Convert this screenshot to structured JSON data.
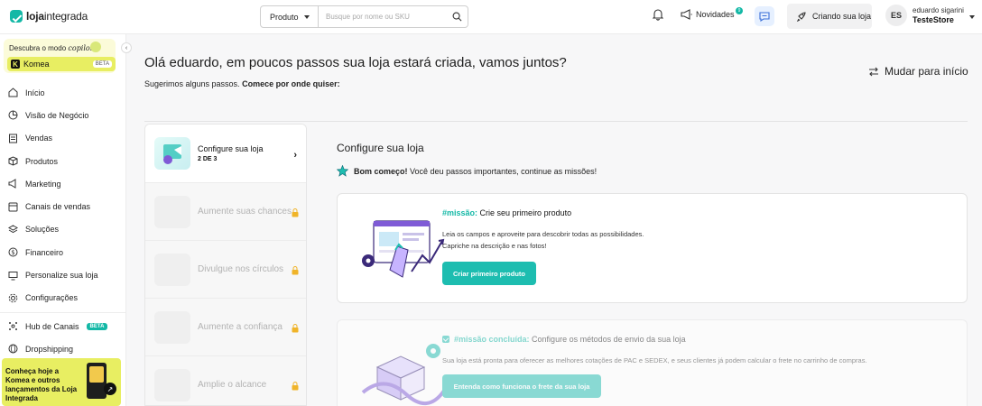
{
  "brand": {
    "name_bold": "loja",
    "name_rest": "integrada",
    "accent": "#13b8a6"
  },
  "topbar": {
    "search_select": "Produto",
    "search_placeholder": "Busque por nome ou SKU",
    "novidades_label": "Novidades",
    "novidades_count": "9",
    "create_store_label": "Criando sua loja",
    "user_initials": "ES",
    "user_name": "eduardo sigarini",
    "user_store": "TesteStore"
  },
  "sidebar": {
    "copilot_title_prefix": "Descubra o modo",
    "copilot_title_italic": "copiloto",
    "komea_label": "Komea",
    "komea_badge": "BETA",
    "collapse_icon": "‹",
    "items": [
      {
        "label": "Início",
        "icon": "home-icon"
      },
      {
        "label": "Visão de Negócio",
        "icon": "chart-icon"
      },
      {
        "label": "Vendas",
        "icon": "receipt-icon"
      },
      {
        "label": "Produtos",
        "icon": "box-icon"
      },
      {
        "label": "Marketing",
        "icon": "megaphone-icon"
      },
      {
        "label": "Canais de vendas",
        "icon": "channels-icon"
      },
      {
        "label": "Soluções",
        "icon": "layers-icon"
      },
      {
        "label": "Financeiro",
        "icon": "dollar-icon"
      },
      {
        "label": "Personalize sua loja",
        "icon": "monitor-icon"
      },
      {
        "label": "Configurações",
        "icon": "gear-icon"
      }
    ],
    "extra_items": [
      {
        "label": "Hub de Canais",
        "badge": "BETA",
        "icon": "hub-icon"
      },
      {
        "label": "Dropshipping",
        "icon": "globe-icon"
      }
    ],
    "promo_text": "Conheça hoje a Komea e outros lançamentos da Loja Integrada",
    "promo_arrow": "↗"
  },
  "main": {
    "greeting": "Olá eduardo, em poucos passos sua loja estará criada, vamos juntos?",
    "sub_plain": "Sugerimos alguns passos.",
    "sub_bold": "Comece por onde quiser:",
    "switch_label": "Mudar para início"
  },
  "steps": [
    {
      "label": "Configure sua loja",
      "progress": "2 DE 3",
      "state": "active"
    },
    {
      "label": "Aumente suas chances",
      "state": "locked"
    },
    {
      "label": "Divulgue nos círculos",
      "state": "locked"
    },
    {
      "label": "Aumente a confiança",
      "state": "locked"
    },
    {
      "label": "Amplie o alcance",
      "state": "locked"
    }
  ],
  "panel": {
    "title": "Configure sua loja",
    "sub_bold": "Bom começo!",
    "sub_rest": "Você deu passos importantes, continue as missões!"
  },
  "missions": [
    {
      "tag": "#missão:",
      "title": "Crie seu primeiro produto",
      "desc1": "Leia os campos e aproveite para descobrir todas as possibilidades.",
      "desc2": "Capriche na descrição e nas fotos!",
      "cta": "Criar primeiro produto"
    },
    {
      "tag": "#missão concluída:",
      "title": "Configure os métodos de envio da sua loja",
      "desc1": "Sua loja está pronta para oferecer as melhores cotações de PAC e SEDEX, e seus clientes já podem calcular o frete no carrinho de compras.",
      "cta": "Entenda como funciona o frete da sua loja"
    }
  ]
}
